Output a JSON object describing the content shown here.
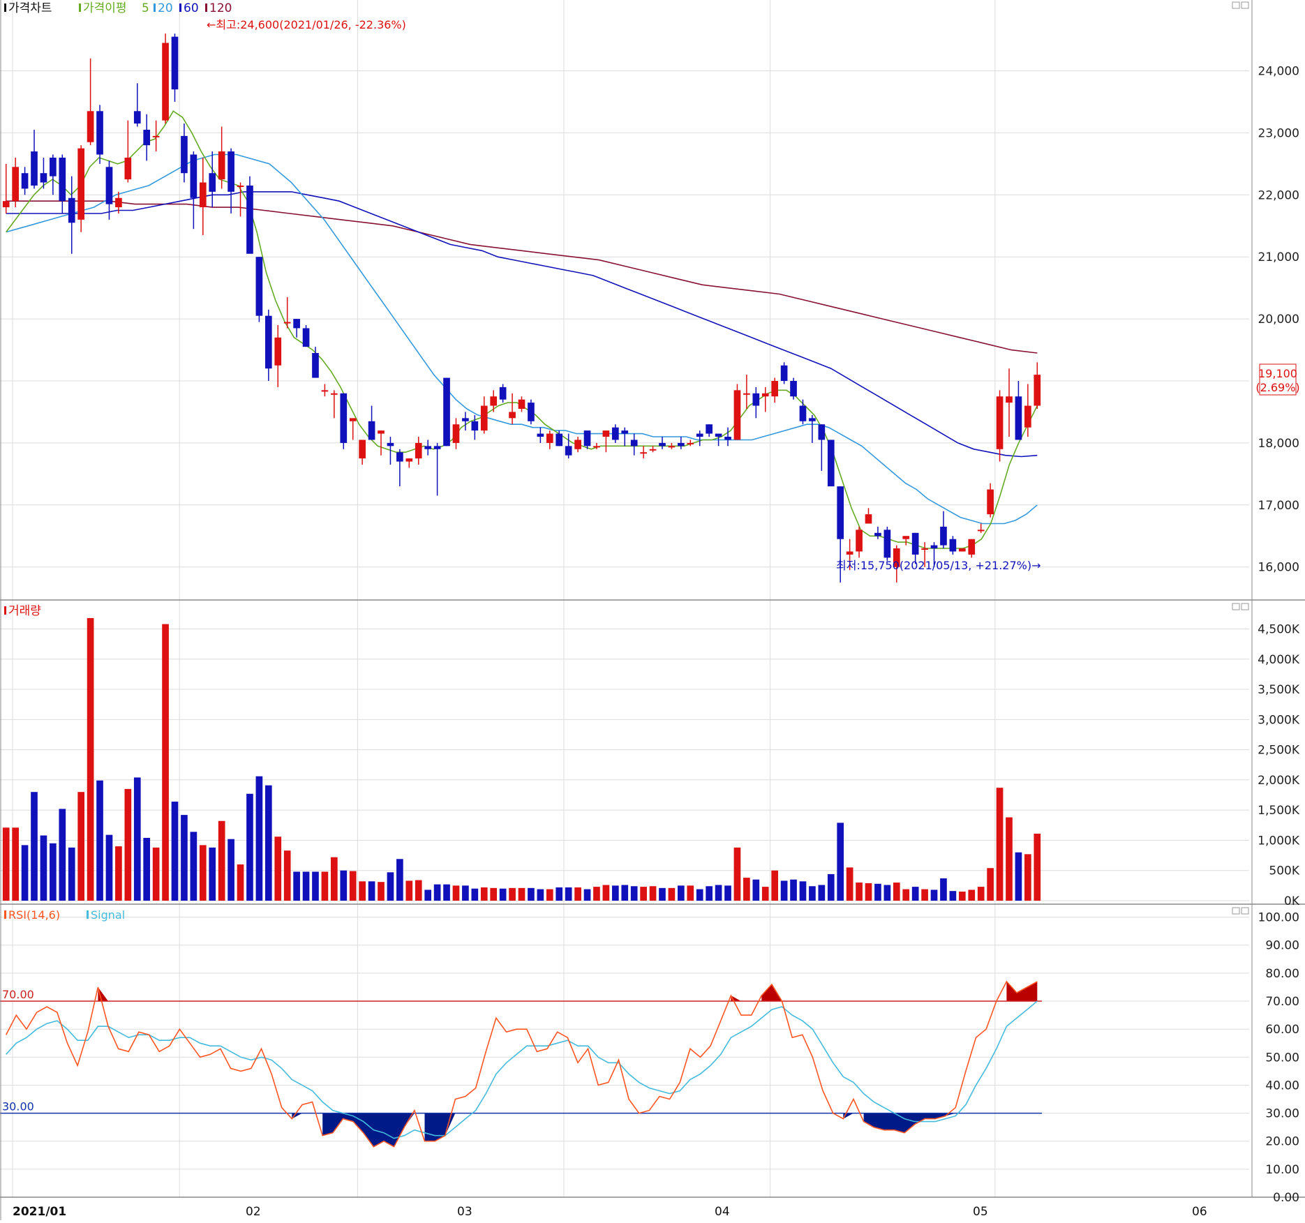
{
  "price_panel": {
    "legend": {
      "title": "가격차트",
      "ma_label": "가격이평",
      "ma_periods": [
        "5",
        "20",
        "60",
        "120"
      ],
      "ma_colors": [
        "#66aa22",
        "#3399dd",
        "#1111bb",
        "#881133"
      ]
    },
    "high_annotation": "←최고:24,600(2021/01/26, -22.36%)",
    "low_annotation": "최저:15,750(2021/05/13, +21.27%)→",
    "current_price": "19,100",
    "current_change": "(2.69%)",
    "y_ticks": [
      "24,000",
      "23,000",
      "22,000",
      "21,000",
      "20,000",
      "19,000",
      "18,000",
      "17,000",
      "16,000"
    ]
  },
  "volume_panel": {
    "title": "거래량",
    "y_ticks": [
      "4,500K",
      "4,000K",
      "3,500K",
      "3,000K",
      "2,500K",
      "2,000K",
      "1,500K",
      "1,000K",
      "500K",
      "0K"
    ]
  },
  "rsi_panel": {
    "title": "RSI(14,6)",
    "signal_label": "Signal",
    "upper_label": "70.00",
    "lower_label": "30.00",
    "y_ticks": [
      "100.00",
      "90.00",
      "80.00",
      "70.00",
      "60.00",
      "50.00",
      "40.00",
      "30.00",
      "20.00",
      "10.00",
      "0.00"
    ]
  },
  "x_axis": {
    "labels": [
      "2021/01",
      "02",
      "03",
      "04",
      "05",
      "06"
    ]
  },
  "colors": {
    "up": "#dd1111",
    "down": "#1111bb",
    "ma5": "#66aa22",
    "ma20": "#3399dd",
    "ma60": "#1111bb",
    "ma120": "#881133",
    "rsi": "#ff5522",
    "signal": "#44bbdd",
    "rsi_over": "#bb0000",
    "rsi_under": "#001a88"
  },
  "chart_data": {
    "type": "candlestick",
    "x": [
      "2021/01",
      "02",
      "03",
      "04",
      "05",
      "06"
    ],
    "candles": [
      {
        "o": 21800,
        "h": 22500,
        "l": 21700,
        "c": 21900
      },
      {
        "o": 21900,
        "h": 22600,
        "l": 21800,
        "c": 22450
      },
      {
        "o": 22350,
        "h": 22450,
        "l": 22000,
        "c": 22100
      },
      {
        "o": 22700,
        "h": 23050,
        "l": 22100,
        "c": 22150
      },
      {
        "o": 22350,
        "h": 22600,
        "l": 22100,
        "c": 22200
      },
      {
        "o": 22600,
        "h": 22650,
        "l": 22000,
        "c": 22300
      },
      {
        "o": 22600,
        "h": 22650,
        "l": 21700,
        "c": 21900
      },
      {
        "o": 21950,
        "h": 22300,
        "l": 21050,
        "c": 21550
      },
      {
        "o": 21600,
        "h": 22800,
        "l": 21400,
        "c": 22750
      },
      {
        "o": 22850,
        "h": 24200,
        "l": 22800,
        "c": 23350
      },
      {
        "o": 23350,
        "h": 23450,
        "l": 22500,
        "c": 22650
      },
      {
        "o": 22450,
        "h": 22550,
        "l": 21600,
        "c": 21850
      },
      {
        "o": 21800,
        "h": 22050,
        "l": 21700,
        "c": 21950
      },
      {
        "o": 22250,
        "h": 23200,
        "l": 22200,
        "c": 22600
      },
      {
        "o": 23350,
        "h": 23800,
        "l": 23100,
        "c": 23150
      },
      {
        "o": 23050,
        "h": 23300,
        "l": 22550,
        "c": 22800
      },
      {
        "o": 22950,
        "h": 23200,
        "l": 22700,
        "c": 22950
      },
      {
        "o": 23200,
        "h": 24600,
        "l": 23150,
        "c": 24450
      },
      {
        "o": 24550,
        "h": 24600,
        "l": 23500,
        "c": 23700
      },
      {
        "o": 22950,
        "h": 23150,
        "l": 22200,
        "c": 22350
      },
      {
        "o": 22650,
        "h": 22700,
        "l": 21450,
        "c": 21950
      },
      {
        "o": 21800,
        "h": 22600,
        "l": 21350,
        "c": 22200
      },
      {
        "o": 22350,
        "h": 22700,
        "l": 21800,
        "c": 22050
      },
      {
        "o": 22250,
        "h": 23100,
        "l": 22100,
        "c": 22700
      },
      {
        "o": 22700,
        "h": 22750,
        "l": 21700,
        "c": 22050
      },
      {
        "o": 22150,
        "h": 22200,
        "l": 21650,
        "c": 22150
      },
      {
        "o": 22150,
        "h": 22300,
        "l": 21100,
        "c": 21050
      },
      {
        "o": 21000,
        "h": 21000,
        "l": 19950,
        "c": 20050
      },
      {
        "o": 20050,
        "h": 20150,
        "l": 19000,
        "c": 19200
      },
      {
        "o": 19250,
        "h": 19900,
        "l": 18900,
        "c": 19700
      },
      {
        "o": 19950,
        "h": 20350,
        "l": 19850,
        "c": 19950
      },
      {
        "o": 20000,
        "h": 20000,
        "l": 19700,
        "c": 19850
      },
      {
        "o": 19850,
        "h": 19900,
        "l": 19550,
        "c": 19550
      },
      {
        "o": 19450,
        "h": 19550,
        "l": 19100,
        "c": 19050
      },
      {
        "o": 18850,
        "h": 18950,
        "l": 18750,
        "c": 18850
      },
      {
        "o": 18800,
        "h": 18850,
        "l": 18400,
        "c": 18800
      },
      {
        "o": 18800,
        "h": 18800,
        "l": 17900,
        "c": 18000
      },
      {
        "o": 18350,
        "h": 18350,
        "l": 18050,
        "c": 18400
      },
      {
        "o": 17750,
        "h": 18050,
        "l": 17650,
        "c": 18050
      },
      {
        "o": 18350,
        "h": 18600,
        "l": 18050,
        "c": 18050
      },
      {
        "o": 18150,
        "h": 18200,
        "l": 17800,
        "c": 18200
      },
      {
        "o": 18000,
        "h": 18100,
        "l": 17650,
        "c": 17950
      },
      {
        "o": 17850,
        "h": 17900,
        "l": 17300,
        "c": 17700
      },
      {
        "o": 17700,
        "h": 17750,
        "l": 17600,
        "c": 17750
      },
      {
        "o": 17750,
        "h": 18100,
        "l": 17650,
        "c": 18000
      },
      {
        "o": 17950,
        "h": 18050,
        "l": 17800,
        "c": 17900
      },
      {
        "o": 17950,
        "h": 18000,
        "l": 17150,
        "c": 17900
      },
      {
        "o": 19050,
        "h": 19050,
        "l": 17950,
        "c": 17950
      },
      {
        "o": 18000,
        "h": 18400,
        "l": 17900,
        "c": 18300
      },
      {
        "o": 18400,
        "h": 18500,
        "l": 18200,
        "c": 18350
      },
      {
        "o": 18350,
        "h": 18450,
        "l": 18050,
        "c": 18200
      },
      {
        "o": 18200,
        "h": 18750,
        "l": 18150,
        "c": 18600
      },
      {
        "o": 18600,
        "h": 18850,
        "l": 18500,
        "c": 18750
      },
      {
        "o": 18900,
        "h": 18950,
        "l": 18650,
        "c": 18700
      },
      {
        "o": 18400,
        "h": 18800,
        "l": 18300,
        "c": 18500
      },
      {
        "o": 18550,
        "h": 18750,
        "l": 18500,
        "c": 18700
      },
      {
        "o": 18650,
        "h": 18700,
        "l": 18300,
        "c": 18350
      },
      {
        "o": 18150,
        "h": 18250,
        "l": 18000,
        "c": 18100
      },
      {
        "o": 18000,
        "h": 18200,
        "l": 17900,
        "c": 18150
      },
      {
        "o": 18150,
        "h": 18200,
        "l": 17950,
        "c": 17950
      },
      {
        "o": 17950,
        "h": 18150,
        "l": 17750,
        "c": 17800
      },
      {
        "o": 17900,
        "h": 18100,
        "l": 17850,
        "c": 18050
      },
      {
        "o": 18200,
        "h": 18200,
        "l": 17900,
        "c": 17950
      },
      {
        "o": 17950,
        "h": 18000,
        "l": 17900,
        "c": 17950
      },
      {
        "o": 18100,
        "h": 18200,
        "l": 17850,
        "c": 18200
      },
      {
        "o": 18250,
        "h": 18300,
        "l": 18000,
        "c": 18050
      },
      {
        "o": 18200,
        "h": 18250,
        "l": 17950,
        "c": 18150
      },
      {
        "o": 18050,
        "h": 18150,
        "l": 17800,
        "c": 17950
      },
      {
        "o": 17850,
        "h": 17950,
        "l": 17750,
        "c": 17850
      },
      {
        "o": 17900,
        "h": 17950,
        "l": 17850,
        "c": 17900
      },
      {
        "o": 18000,
        "h": 18100,
        "l": 17900,
        "c": 17950
      },
      {
        "o": 17950,
        "h": 18000,
        "l": 17900,
        "c": 17950
      },
      {
        "o": 18000,
        "h": 18100,
        "l": 17900,
        "c": 17950
      },
      {
        "o": 18000,
        "h": 18050,
        "l": 17950,
        "c": 18000
      },
      {
        "o": 18150,
        "h": 18200,
        "l": 17950,
        "c": 18100
      },
      {
        "o": 18300,
        "h": 18300,
        "l": 18100,
        "c": 18150
      },
      {
        "o": 18150,
        "h": 18150,
        "l": 17950,
        "c": 18100
      },
      {
        "o": 18100,
        "h": 18250,
        "l": 17950,
        "c": 18050
      },
      {
        "o": 18050,
        "h": 18950,
        "l": 18050,
        "c": 18850
      },
      {
        "o": 18800,
        "h": 19100,
        "l": 18550,
        "c": 18800
      },
      {
        "o": 18800,
        "h": 18900,
        "l": 18400,
        "c": 18600
      },
      {
        "o": 18750,
        "h": 18900,
        "l": 18500,
        "c": 18800
      },
      {
        "o": 18750,
        "h": 19050,
        "l": 18650,
        "c": 19000
      },
      {
        "o": 19250,
        "h": 19300,
        "l": 18950,
        "c": 19000
      },
      {
        "o": 19000,
        "h": 19050,
        "l": 18700,
        "c": 18750
      },
      {
        "o": 18600,
        "h": 18700,
        "l": 18300,
        "c": 18350
      },
      {
        "o": 18400,
        "h": 18450,
        "l": 18000,
        "c": 18350
      },
      {
        "o": 18300,
        "h": 18300,
        "l": 17550,
        "c": 18050
      },
      {
        "o": 18050,
        "h": 18050,
        "l": 17350,
        "c": 17300
      },
      {
        "o": 17300,
        "h": 17300,
        "l": 15750,
        "c": 16450
      },
      {
        "o": 16200,
        "h": 16450,
        "l": 15950,
        "c": 16250
      },
      {
        "o": 16250,
        "h": 16650,
        "l": 16150,
        "c": 16600
      },
      {
        "o": 16700,
        "h": 16950,
        "l": 16700,
        "c": 16850
      },
      {
        "o": 16550,
        "h": 16650,
        "l": 16450,
        "c": 16500
      },
      {
        "o": 16600,
        "h": 16650,
        "l": 16100,
        "c": 16150
      },
      {
        "o": 16000,
        "h": 16350,
        "l": 15750,
        "c": 16300
      },
      {
        "o": 16450,
        "h": 16500,
        "l": 16350,
        "c": 16500
      },
      {
        "o": 16550,
        "h": 16550,
        "l": 16050,
        "c": 16200
      },
      {
        "o": 16300,
        "h": 16400,
        "l": 16000,
        "c": 16300
      },
      {
        "o": 16350,
        "h": 16400,
        "l": 16000,
        "c": 16300
      },
      {
        "o": 16650,
        "h": 16900,
        "l": 16300,
        "c": 16350
      },
      {
        "o": 16450,
        "h": 16500,
        "l": 16200,
        "c": 16250
      },
      {
        "o": 16250,
        "h": 16300,
        "l": 16250,
        "c": 16300
      },
      {
        "o": 16200,
        "h": 16450,
        "l": 16150,
        "c": 16450
      },
      {
        "o": 16600,
        "h": 16700,
        "l": 16550,
        "c": 16600
      },
      {
        "o": 16850,
        "h": 17350,
        "l": 16800,
        "c": 17250
      },
      {
        "o": 17900,
        "h": 18850,
        "l": 17700,
        "c": 18750
      },
      {
        "o": 18650,
        "h": 19200,
        "l": 18100,
        "c": 18750
      },
      {
        "o": 18750,
        "h": 19000,
        "l": 18050,
        "c": 18050
      },
      {
        "o": 18250,
        "h": 18950,
        "l": 18100,
        "c": 18600
      },
      {
        "o": 18600,
        "h": 19300,
        "l": 18550,
        "c": 19100
      }
    ],
    "volume_k": [
      1210,
      1210,
      920,
      1800,
      1080,
      950,
      1520,
      880,
      1800,
      4680,
      1990,
      1090,
      900,
      1850,
      2040,
      1040,
      880,
      4580,
      1640,
      1420,
      1140,
      920,
      880,
      1320,
      1020,
      600,
      1770,
      2060,
      1910,
      1060,
      830,
      480,
      480,
      480,
      480,
      720,
      500,
      490,
      320,
      320,
      310,
      470,
      690,
      330,
      340,
      180,
      270,
      270,
      250,
      250,
      200,
      220,
      210,
      200,
      210,
      210,
      210,
      190,
      190,
      220,
      220,
      220,
      190,
      230,
      260,
      250,
      260,
      240,
      230,
      240,
      210,
      210,
      250,
      250,
      190,
      240,
      260,
      250,
      880,
      380,
      350,
      230,
      500,
      330,
      350,
      320,
      240,
      260,
      440,
      1290,
      550,
      300,
      290,
      280,
      260,
      300,
      190,
      230,
      190,
      180,
      370,
      160,
      150,
      180,
      230,
      540,
      1870,
      1380,
      800,
      770,
      1110
    ],
    "rsi": [
      58,
      65,
      60,
      66,
      68,
      66,
      55,
      47,
      59,
      75,
      61,
      53,
      52,
      59,
      58,
      52,
      54,
      60,
      55,
      50,
      51,
      53,
      46,
      45,
      46,
      53,
      44,
      32,
      28,
      33,
      34,
      22,
      23,
      28,
      27,
      23,
      18,
      20,
      18,
      25,
      31,
      20,
      20,
      22,
      35,
      36,
      39,
      52,
      64,
      59,
      60,
      60,
      52,
      53,
      59,
      57,
      48,
      53,
      40,
      41,
      49,
      35,
      30,
      31,
      36,
      35,
      41,
      53,
      50,
      54,
      63,
      72,
      65,
      65,
      72,
      76,
      70,
      57,
      58,
      50,
      38,
      30,
      28,
      35,
      27,
      25,
      24,
      24,
      23,
      26,
      28,
      28,
      29,
      32,
      45,
      57,
      60,
      70,
      77,
      73,
      75,
      77
    ],
    "signal": [
      51,
      55,
      57,
      60,
      62,
      63,
      60,
      56,
      56,
      61,
      61,
      59,
      57,
      58,
      58,
      56,
      56,
      57,
      57,
      55,
      54,
      54,
      52,
      50,
      49,
      50,
      49,
      46,
      42,
      40,
      38,
      34,
      31,
      30,
      29,
      27,
      24,
      23,
      21,
      22,
      24,
      23,
      22,
      22,
      25,
      28,
      31,
      37,
      44,
      48,
      51,
      54,
      54,
      54,
      55,
      56,
      54,
      54,
      50,
      48,
      48,
      44,
      41,
      39,
      38,
      37,
      38,
      42,
      44,
      47,
      51,
      57,
      59,
      61,
      64,
      67,
      68,
      65,
      63,
      60,
      54,
      48,
      43,
      41,
      37,
      34,
      32,
      30,
      28,
      27,
      27,
      27,
      28,
      29,
      33,
      40,
      46,
      53,
      61,
      64,
      67,
      70
    ],
    "ma5": [
      21400,
      21600,
      21800,
      22000,
      22150,
      22250,
      22150,
      22000,
      22150,
      22450,
      22600,
      22550,
      22500,
      22550,
      22700,
      22850,
      22900,
      23100,
      23350,
      23250,
      23000,
      22700,
      22450,
      22250,
      22200,
      22150,
      21900,
      21400,
      20750,
      20300,
      19950,
      19700,
      19600,
      19500,
      19350,
      19150,
      18900,
      18600,
      18300,
      18100,
      17950,
      17900,
      17850,
      17850,
      17900,
      17950,
      17900,
      17950,
      18050,
      18250,
      18350,
      18400,
      18500,
      18600,
      18650,
      18650,
      18550,
      18450,
      18300,
      18200,
      18100,
      18000,
      17950,
      17900,
      17950,
      17950,
      17950,
      17950,
      17950,
      17950,
      17950,
      17950,
      17950,
      17950,
      18000,
      18050,
      18050,
      18100,
      18200,
      18400,
      18600,
      18700,
      18800,
      18850,
      18850,
      18750,
      18600,
      18450,
      18200,
      17850,
      17400,
      16950,
      16600,
      16500,
      16500,
      16450,
      16400,
      16400,
      16350,
      16300,
      16300,
      16300,
      16300,
      16300,
      16350,
      16450,
      16700,
      17150,
      17650,
      18000,
      18300,
      18600
    ],
    "ma20": [
      21400,
      21450,
      21500,
      21550,
      21600,
      21650,
      21700,
      21750,
      21800,
      21900,
      22000,
      22050,
      22100,
      22150,
      22250,
      22350,
      22450,
      22550,
      22600,
      22650,
      22650,
      22650,
      22600,
      22550,
      22500,
      22350,
      22200,
      22000,
      21800,
      21600,
      21350,
      21100,
      20850,
      20600,
      20350,
      20100,
      19850,
      19600,
      19350,
      19100,
      18900,
      18700,
      18550,
      18450,
      18400,
      18350,
      18300,
      18300,
      18250,
      18250,
      18200,
      18200,
      18150,
      18150,
      18150,
      18150,
      18150,
      18150,
      18150,
      18100,
      18100,
      18100,
      18100,
      18050,
      18050,
      18050,
      18050,
      18050,
      18050,
      18100,
      18150,
      18200,
      18250,
      18300,
      18300,
      18250,
      18150,
      18050,
      17950,
      17800,
      17650,
      17500,
      17350,
      17250,
      17100,
      17000,
      16900,
      16800,
      16750,
      16700,
      16700,
      16700,
      16750,
      16850,
      17000
    ],
    "ma60": [
      21700,
      21700,
      21700,
      21700,
      21700,
      21700,
      21700,
      21750,
      21750,
      21800,
      21850,
      21900,
      21950,
      22000,
      22000,
      22050,
      22050,
      22050,
      22050,
      22000,
      21950,
      21900,
      21800,
      21700,
      21600,
      21500,
      21400,
      21300,
      21200,
      21150,
      21100,
      21000,
      20950,
      20900,
      20850,
      20800,
      20750,
      20700,
      20600,
      20500,
      20400,
      20300,
      20200,
      20100,
      20000,
      19900,
      19800,
      19700,
      19600,
      19500,
      19400,
      19300,
      19200,
      19050,
      18900,
      18750,
      18600,
      18450,
      18300,
      18150,
      18000,
      17900,
      17850,
      17800,
      17780,
      17800
    ],
    "ma120": [
      21900,
      21900,
      21900,
      21900,
      21900,
      21850,
      21850,
      21850,
      21800,
      21800,
      21750,
      21700,
      21650,
      21600,
      21550,
      21500,
      21400,
      21300,
      21200,
      21150,
      21100,
      21050,
      21000,
      20950,
      20850,
      20750,
      20650,
      20550,
      20500,
      20450,
      20400,
      20300,
      20200,
      20100,
      20000,
      19900,
      19800,
      19700,
      19600,
      19500,
      19450
    ]
  }
}
